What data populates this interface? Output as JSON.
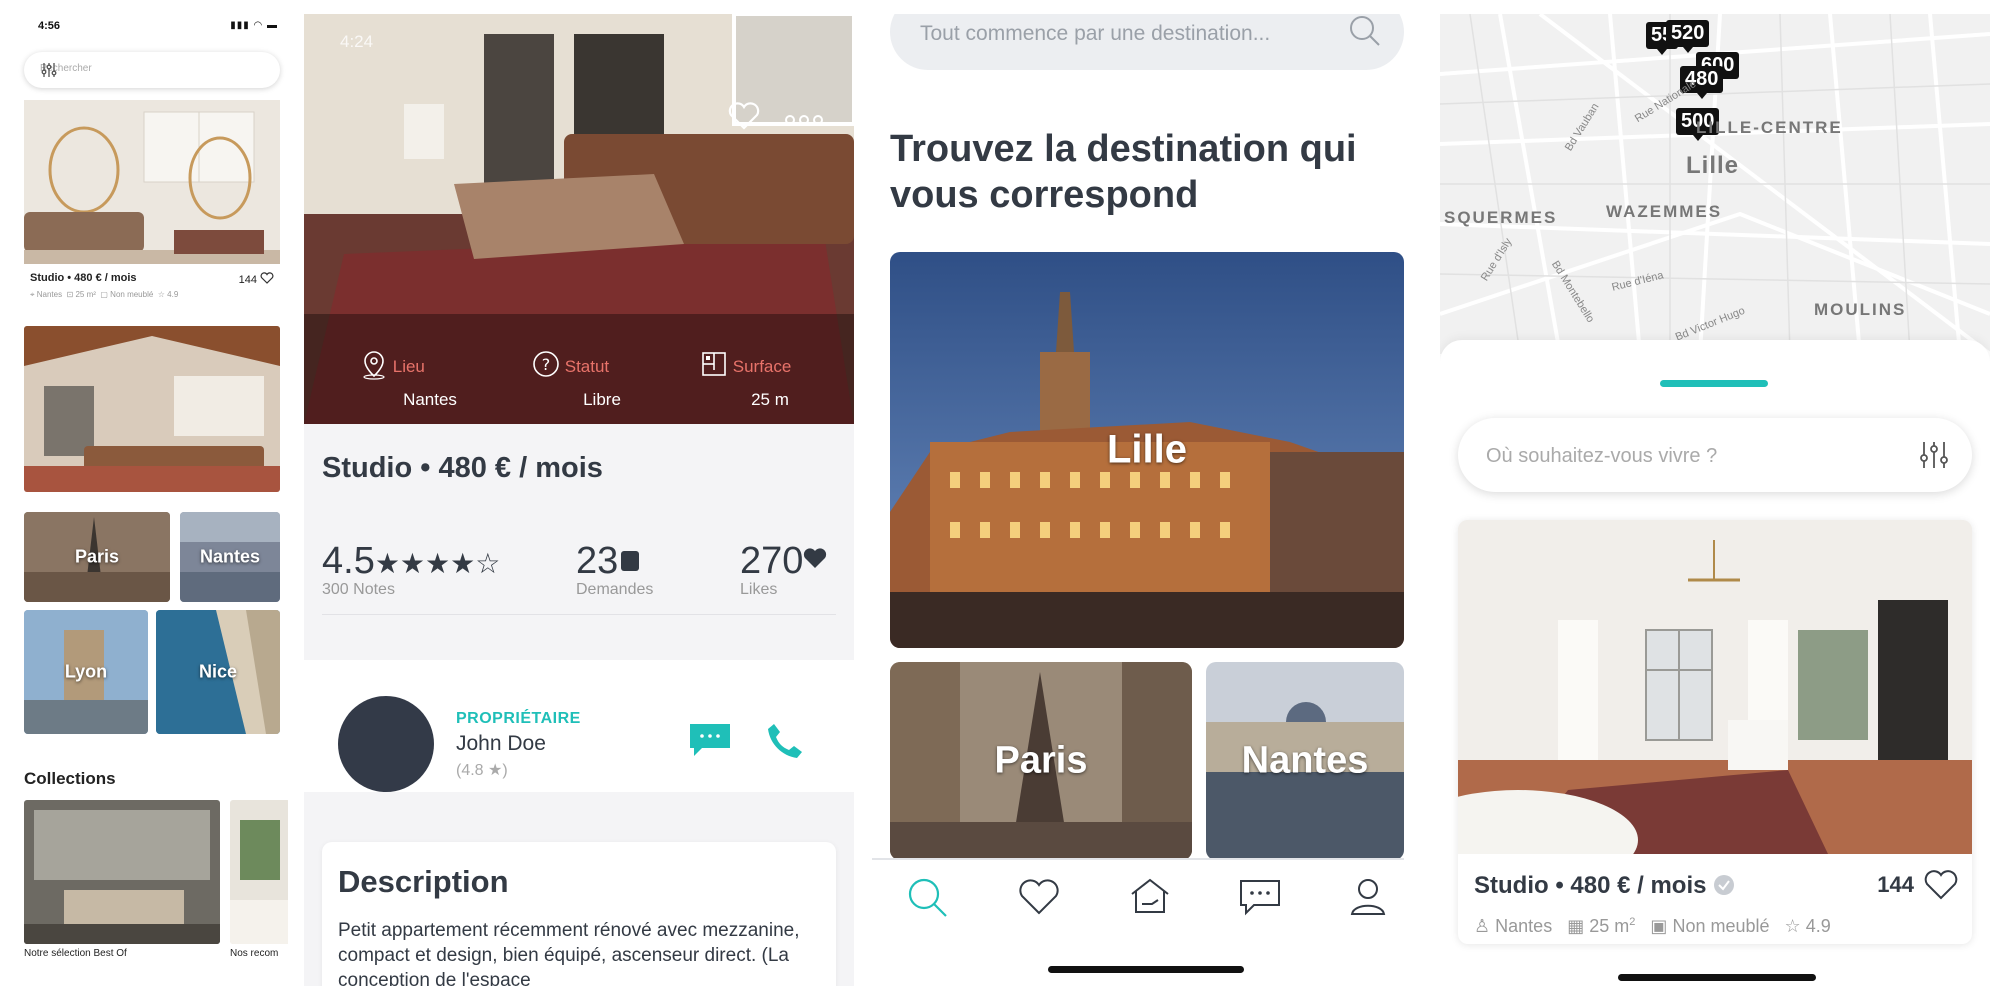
{
  "panel1": {
    "status_time": "4:56",
    "search_placeholder": "Rechercher",
    "listing": {
      "title": "Studio • 480 € / mois",
      "likes": "144",
      "city": "Nantes",
      "surface": "25 m²",
      "furnished": "Non meublé",
      "rating": "4.9"
    },
    "cities": [
      "Paris",
      "Nantes",
      "Lyon",
      "Nice"
    ],
    "collections_heading": "Collections",
    "collections": [
      "Notre sélection Best Of",
      "Nos recom"
    ]
  },
  "panel2": {
    "status_time": "4:24",
    "features": [
      {
        "label": "Lieu",
        "value": "Nantes",
        "icon": "location-pin-icon"
      },
      {
        "label": "Statut",
        "value": "Libre",
        "icon": "question-circle-icon"
      },
      {
        "label": "Surface",
        "value": "25 m",
        "icon": "floorplan-icon"
      }
    ],
    "title": "Studio • 480 € / mois",
    "stats": {
      "rating": "4.5",
      "rating_count": "300 Notes",
      "requests": "23",
      "requests_label": "Demandes",
      "likes": "270",
      "likes_label": "Likes"
    },
    "owner": {
      "role": "PROPRIÉTAIRE",
      "name": "John Doe",
      "rating": "(4.8 ★)"
    },
    "description": {
      "heading": "Description",
      "text": "Petit appartement récemment rénové avec mezzanine, compact et design, bien équipé, ascenseur direct. (La conception de l'espace"
    }
  },
  "panel3": {
    "search_placeholder": "Tout commence par une destination...",
    "headline": "Trouvez la destination qui vous correspond",
    "destinations": [
      "Lille",
      "Paris",
      "Nantes"
    ],
    "tabs": [
      "search-icon",
      "heart-icon",
      "home-icon",
      "chat-icon",
      "profile-icon"
    ]
  },
  "panel4": {
    "map": {
      "pins": [
        "55",
        "520",
        "600",
        "480",
        "500"
      ],
      "districts": [
        "LILLE-CENTRE",
        "Lille",
        "SQUERMES",
        "WAZEMMES",
        "MOULINS"
      ],
      "streets": [
        "Rue Nationale",
        "Bd Vauban",
        "Rue d'Isly",
        "Bd Montebello",
        "Rue d'Iéna",
        "Bd Victor Hugo"
      ]
    },
    "search_placeholder": "Où souhaitez-vous vivre ?",
    "listing": {
      "title": "Studio • 480 € / mois",
      "likes": "144",
      "city": "Nantes",
      "surface": "25 m",
      "surface_sup": "2",
      "furnished": "Non meublé",
      "rating": "4.9"
    }
  },
  "colors": {
    "accent_teal": "#1fbfb8",
    "text_dark": "#333a44",
    "feature_label": "#e8736a"
  }
}
